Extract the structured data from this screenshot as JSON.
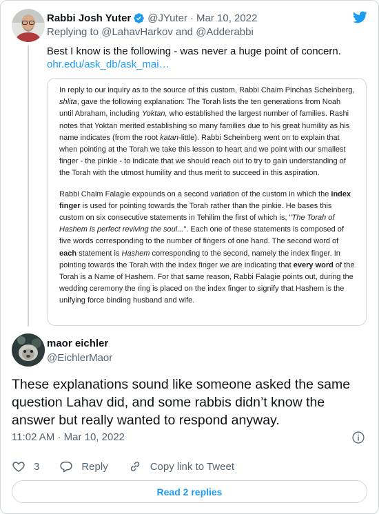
{
  "tweet": {
    "author_name": "Rabbi Josh Yuter",
    "author_handle": "@JYuter",
    "date": "Mar 10, 2022",
    "separator": "·",
    "reply_prefix": "Replying to ",
    "reply_handle_1": "@LahavHarkov",
    "reply_and": " and ",
    "reply_handle_2": "@Adderabbi",
    "text": "Best I know is the following - was never a huge point of concern.",
    "link": "ohr.edu/ask_db/ask_mai…"
  },
  "quoted_image": {
    "paragraph_1": {
      "a": "In reply to our inquiry as to the source of this custom, Rabbi Chaim Pinchas Scheinberg, ",
      "a_italic": "shlita",
      "b": ", gave the following explanation: The Torah lists the ten generations from Noah until Abraham, including ",
      "b_italic": "Yoktan,",
      "c": " who established the largest number of families. Rashi notes that Yoktan merited establishing so many families due to his great humility as his name indicates (from the root ",
      "c_italic": "katan",
      "d": "-little). Rabbi Scheinberg went on to explain that when pointing at the Torah we take this lesson to heart and we point with our smallest finger - the pinkie - to indicate that we should reach out to try to gain understanding of the Torah with the utmost humility and thus merit to succeed in this aspiration."
    },
    "paragraph_2": {
      "a": "Rabbi Chaim Falagie expounds on a second variation of the custom in which the ",
      "a_bold": "index finger",
      "b": " is used for pointing towards the Torah rather than the pinkie. He bases this custom on six consecutive statements in Tehilim the first of which is, \"",
      "b_italic": "The Torah of Hashem is perfect reviving the soul...",
      "c": "\". Each one of these statements is composed of five words corresponding to the number of fingers of one hand. The second word of ",
      "c_bold": "each",
      "d": " statement is ",
      "d_italic": "Hashem",
      "e": " corresponding to the second, namely the index finger. In pointing towards the Torah with the index finger we are indicating that ",
      "e_bold": "every word",
      "f": " of the Torah is a Name of Hashem. For that same reason, Rabbi Falagie points out, during the wedding ceremony the ring is placed on the index finger to signify that Hashem is the unifying force binding husband and wife."
    }
  },
  "reply": {
    "author_name": "maor eichler",
    "author_handle": "@EichlerMaor",
    "text": "These explanations sound like someone asked the same question Lahav did, and some rabbis didn’t know the answer but really wanted to respond anyway.",
    "time": "11:02 AM",
    "separator": " · ",
    "date": "Mar 10, 2022"
  },
  "actions": {
    "like_count": "3",
    "reply_label": "Reply",
    "copy_link_label": "Copy link to Tweet"
  },
  "read_replies_label": "Read 2 replies",
  "colors": {
    "accent": "#1d9bf0",
    "text": "#0f1419",
    "muted": "#536471",
    "border": "#cfd9de"
  }
}
